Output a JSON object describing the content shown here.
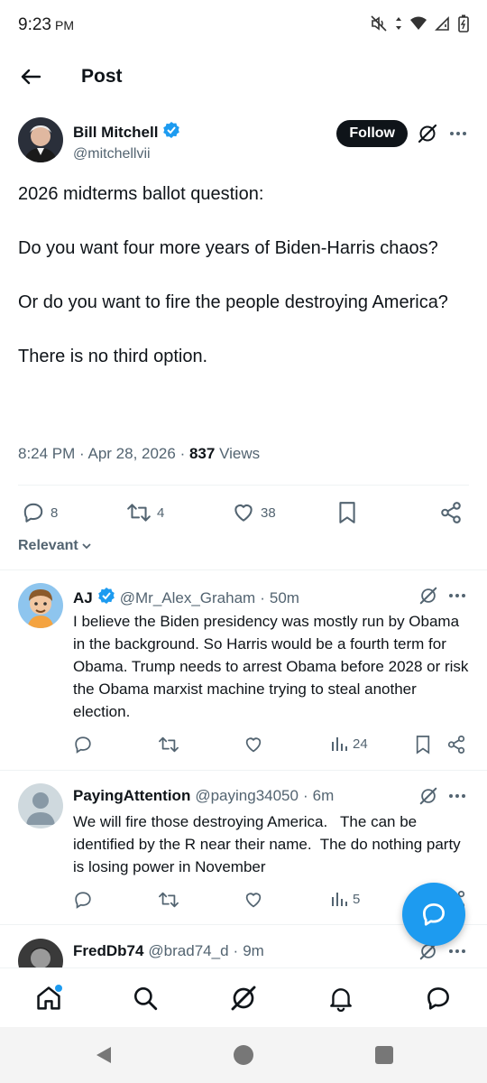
{
  "status_bar": {
    "time": "9:23",
    "ampm": "PM"
  },
  "header": {
    "title": "Post"
  },
  "post": {
    "author_name": "Bill Mitchell",
    "author_handle": "@mitchellvii",
    "follow_label": "Follow",
    "paragraphs": [
      "2026 midterms ballot question:",
      "Do you want four more years of Biden-Harris chaos?",
      "Or do you want to fire the people destroying America?",
      "There is no third option."
    ],
    "time": "8:24 PM",
    "date": "Apr 28, 2026",
    "views_count": "837",
    "views_label": "Views",
    "replies": "8",
    "reposts": "4",
    "likes": "38"
  },
  "sort_label": "Relevant",
  "replies": [
    {
      "name": "AJ",
      "handle": "@Mr_Alex_Graham",
      "time": "50m",
      "text": "I believe the Biden presidency was mostly run by Obama in the background. So Harris would be a fourth term for Obama. Trump needs to arrest Obama before 2028 or risk the Obama marxist machine trying to steal another election.",
      "views": "24"
    },
    {
      "name": "PayingAttention",
      "handle": "@paying34050",
      "time": "6m",
      "text": "We will fire those destroying America.   The can be identified by the R near their name.  The do nothing party is losing power in November",
      "views": "5"
    },
    {
      "name": "FredDb74",
      "handle": "@brad74_d",
      "time": "9m"
    }
  ],
  "colors": {
    "accent": "#1d9bf0",
    "text": "#0f1419",
    "secondary": "#536471"
  }
}
